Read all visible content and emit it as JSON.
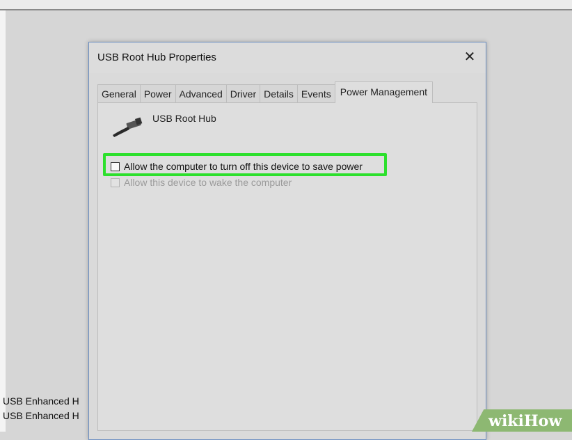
{
  "background_list": [
    "USB Enhanced H",
    "USB Enhanced H"
  ],
  "dialog": {
    "title": "USB Root Hub Properties",
    "close_glyph": "✕",
    "tabs": [
      {
        "label": "General"
      },
      {
        "label": "Power"
      },
      {
        "label": "Advanced"
      },
      {
        "label": "Driver"
      },
      {
        "label": "Details"
      },
      {
        "label": "Events"
      },
      {
        "label": "Power Management"
      }
    ],
    "active_tab": "Power Management",
    "device_name": "USB Root Hub",
    "device_icon": "usb-plug-icon",
    "options": [
      {
        "label": "Allow the computer to turn off this device to save power",
        "checked": false,
        "enabled": true,
        "highlighted": true
      },
      {
        "label": "Allow this device to wake the computer",
        "checked": false,
        "enabled": false
      }
    ]
  },
  "watermark": "wikiHow",
  "colors": {
    "highlight": "#2ce02c",
    "watermark_bg": "#8db872",
    "dialog_border": "#6c8fc2"
  }
}
